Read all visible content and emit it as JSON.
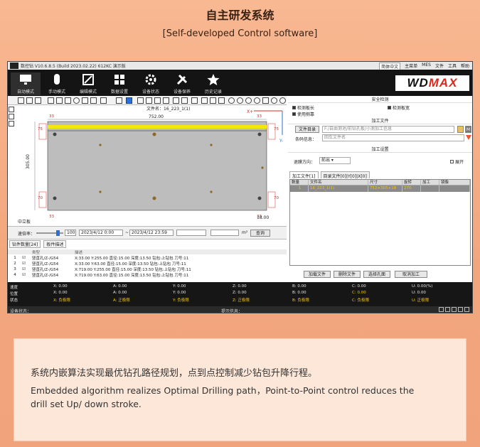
{
  "header": {
    "title": "自主研发系统",
    "subtitle": "[Self-developed Control software]"
  },
  "app": {
    "titlebar": {
      "name": "数控钻  V10.6.8.5 (Build 2023.02.22)  612KC  演示版",
      "lang": "简体中文",
      "user": "主菜单",
      "menu": [
        "MES",
        "文件",
        "工具",
        "帮助"
      ]
    },
    "ribbon": {
      "items": [
        {
          "label": "自动模式",
          "icon": "monitor-icon"
        },
        {
          "label": "手动模式",
          "icon": "mouse-icon"
        },
        {
          "label": "编辑模式",
          "icon": "image-edit-icon"
        },
        {
          "label": "数据设置",
          "icon": "grid-icon"
        },
        {
          "label": "设备状态",
          "icon": "gear-icon"
        },
        {
          "label": "设备保养",
          "icon": "wrench-icon"
        },
        {
          "label": "历史记录",
          "icon": "star-icon"
        }
      ],
      "brand_prefix": "WD",
      "brand_suffix": "MAX"
    },
    "canvas": {
      "file_label": "文件名：16_223_1(1)",
      "dim_top": "752.00",
      "dim_left": "305.00",
      "dim_right_bottom": "18.00",
      "edge_33_top": "33",
      "edge_33_right": "33",
      "edge_33_bottom_left": "33",
      "edge_33_bottom_right": "33",
      "dim_75_left": "75",
      "dim_75_right": "75",
      "dim_70_left": "70",
      "dim_70_right": "70",
      "axis_x": "X+",
      "axis_y": "Y-",
      "board_label": "中立板"
    },
    "bottombar": {
      "speed_label": "速倍率：",
      "speed_value": "100",
      "date_from": "2023/4/12 0:00",
      "date_to": "2023/4/12 23:59",
      "area_unit": "m²",
      "query_button": "查询"
    },
    "log": {
      "tabs": [
        "钻件数量[24]",
        "板件描述"
      ],
      "headers": [
        "",
        "",
        "类型",
        "描述"
      ],
      "rows": [
        {
          "n": "1",
          "type": "竖直孔/Z-/G54",
          "desc": "X:33.00  Y:255.00  直径:15.00  深度:13.50  钻包:上钻包  刀号:11"
        },
        {
          "n": "2",
          "type": "竖直孔/Z-/G54",
          "desc": "X:33.00  Y:63.00  直径:15.00  深度:13.50  钻包:上钻包  刀号:11"
        },
        {
          "n": "3",
          "type": "竖直孔/Z-/G54",
          "desc": "X:719.00  Y:255.00  直径:15.00  深度:13.50  钻包:上钻包  刀号:11"
        },
        {
          "n": "4",
          "type": "竖直孔/Z-/G54",
          "desc": "X:719.00  Y:63.00  直径:15.00  深度:13.50  钻包:上钻包  刀号:11"
        }
      ]
    },
    "right": {
      "safety_title": "安全检测",
      "checks": [
        {
          "label": "检测板长",
          "on": true
        },
        {
          "label": "检测板宽",
          "on": true
        },
        {
          "label": "使用侧靠",
          "on": true
        }
      ],
      "file_title": "加工文件",
      "file_dir_button": "文件目录",
      "file_path": "F:/自由测池/前钻孔板/小测加工信息",
      "barcode_label": "条码信息：",
      "barcode_placeholder": "回车文件名",
      "setting_title": "加工设置",
      "direction_label": "退膜方向：",
      "direction_value": "前出",
      "expand_label": "展开",
      "file_tabs": [
        "加工文件[1]",
        "目录文件[0]|Y[0]|X[0]"
      ],
      "table_headers": [
        "数量",
        "文件名",
        "尺寸",
        "旋转",
        "加工",
        "镜像"
      ],
      "table_rows": [
        {
          "qty": "1",
          "name": "16_223_1(1)",
          "size": "752×305×18",
          "rot": "270",
          "proc": "",
          "mirror": ""
        }
      ],
      "buttons": [
        "加载文件",
        "删除文件",
        "选择孔面",
        "取消加工"
      ]
    },
    "status": {
      "rows": [
        {
          "label": "速度",
          "cells": [
            "X: 0.00",
            "A: 0.00",
            "Y: 0.00",
            "Z: 0.00",
            "B: 0.00",
            "C: 0.00",
            "U: 0.00(%)"
          ]
        },
        {
          "label": "位置",
          "cells": [
            "X: 0.00",
            "A: 0.00",
            "Y: 0.00",
            "Z: 0.00",
            "B: 0.00",
            "C: 0.00",
            "U: 0.00"
          ]
        },
        {
          "label": "状态",
          "cells": [
            "X: 负极限",
            "A: 正极限",
            "Y: 负极限",
            "Z: 正极限",
            "B: 负极限",
            "C: 负极限",
            "U: 正极限"
          ]
        }
      ],
      "footer_left": "设备状态：",
      "footer_mid": "提示信息："
    }
  },
  "description": {
    "zh": "系统内嵌算法实现最优钻孔路径规划，点到点控制减少钻包升降行程。",
    "en1": "Embedded algorithm realizes Optimal Drilling path，Point-to-Point control reduces the",
    "en2": "drill set Up/ down stroke."
  },
  "colors": {
    "accent_blue": "#2d6fd6",
    "warn_yellow": "#f4c800",
    "dim_red": "#d9281c",
    "board_gray": "#bdbdbd"
  }
}
